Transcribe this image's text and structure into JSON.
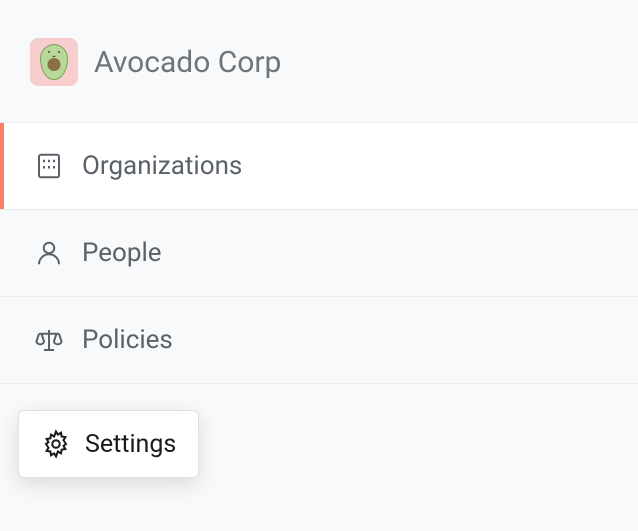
{
  "header": {
    "company_name": "Avocado Corp"
  },
  "nav": {
    "items": [
      {
        "label": "Organizations",
        "active": true
      },
      {
        "label": "People",
        "active": false
      },
      {
        "label": "Policies",
        "active": false
      }
    ]
  },
  "popup": {
    "settings_label": "Settings"
  }
}
